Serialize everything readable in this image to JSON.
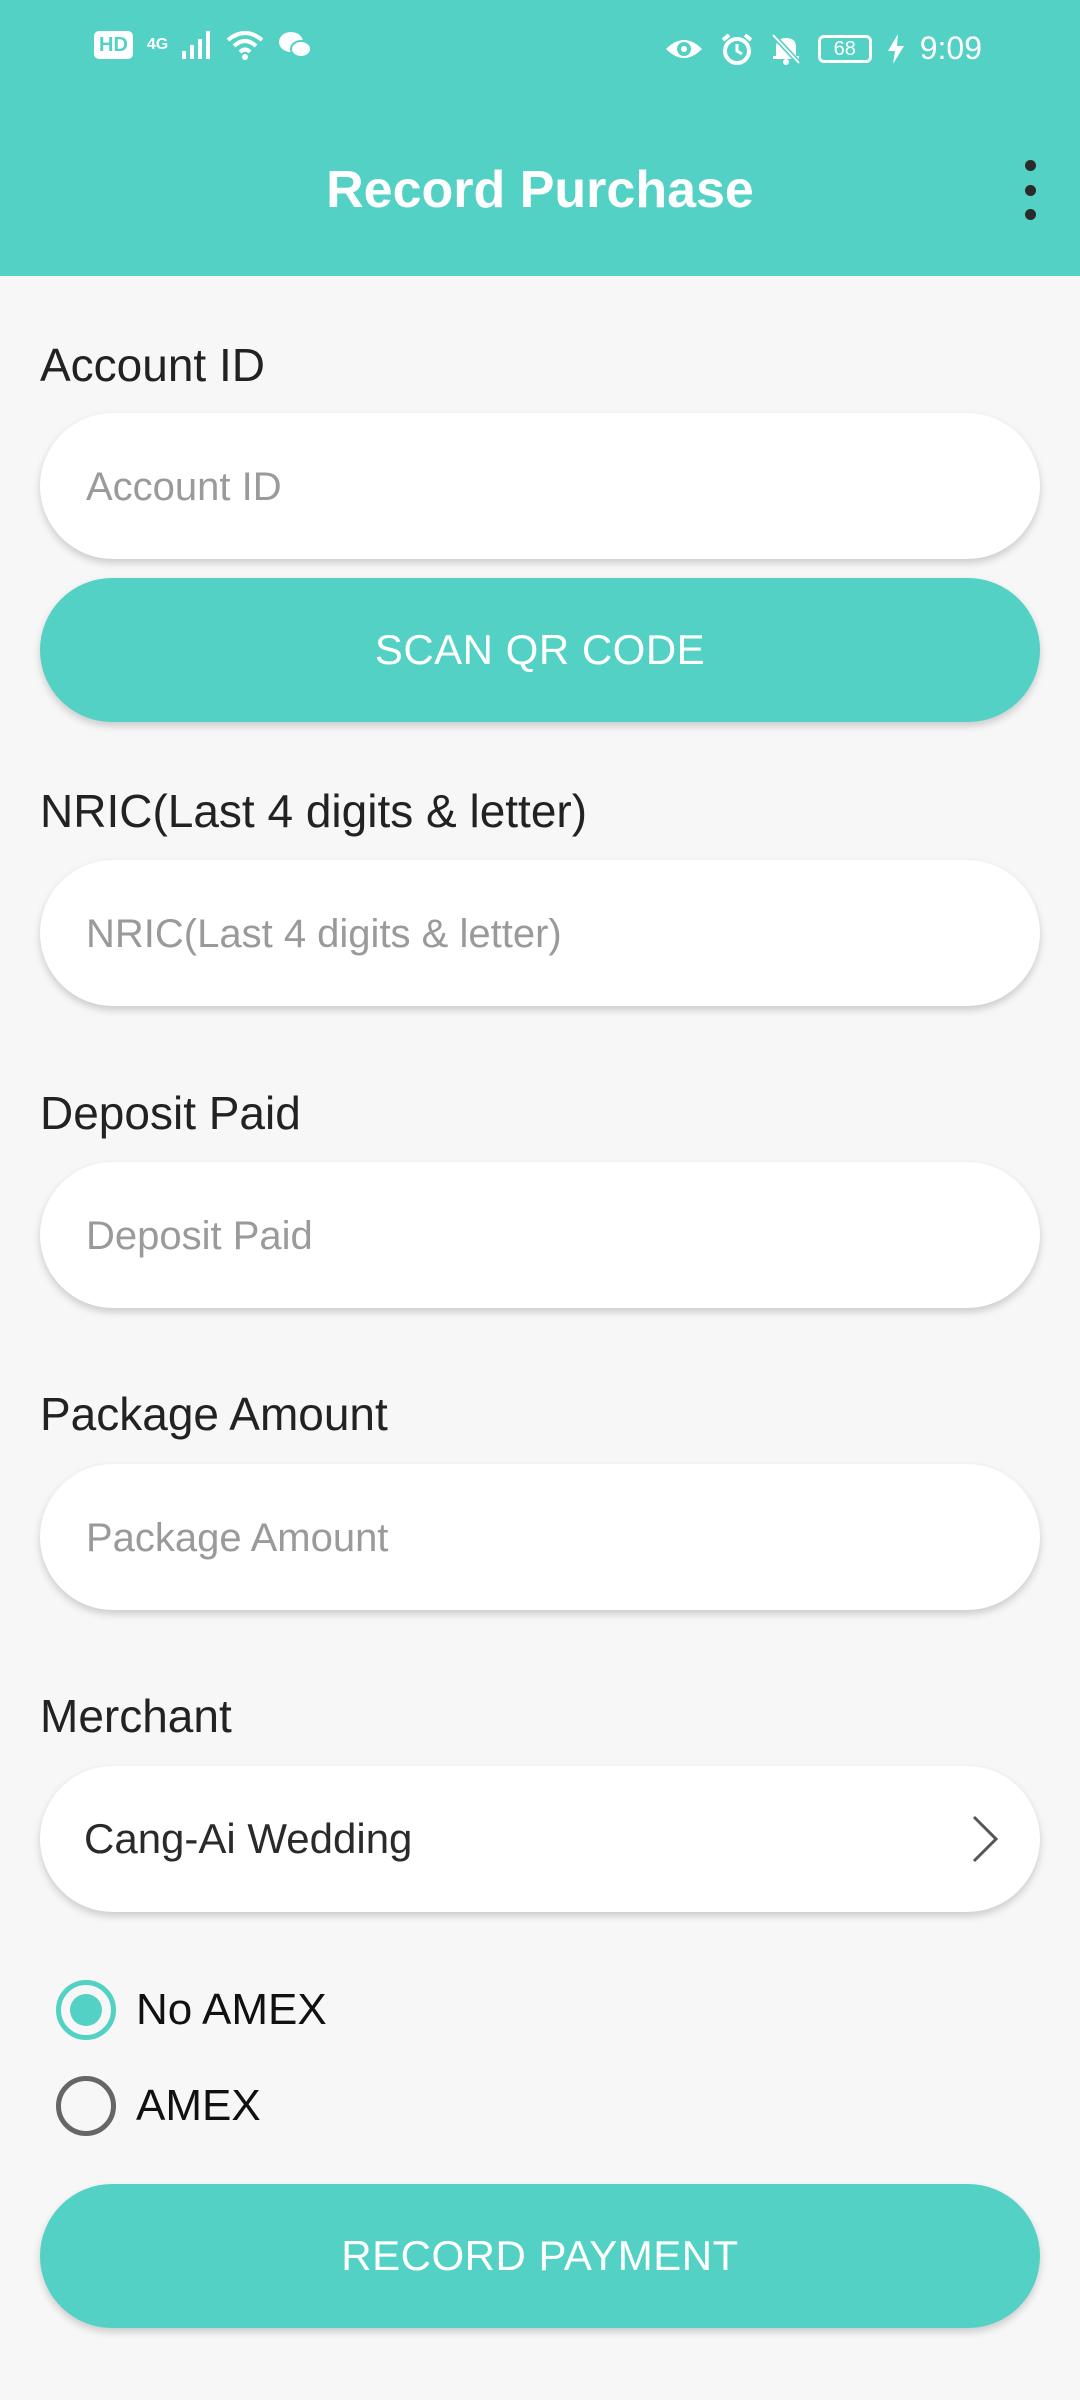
{
  "statusbar": {
    "hd": "HD",
    "network": "4G",
    "battery": "68",
    "time": "9:09",
    "icons": [
      "signal-icon",
      "wifi-icon",
      "wechat-icon",
      "eye-icon",
      "alarm-icon",
      "mute-icon",
      "charging-icon"
    ]
  },
  "appbar": {
    "title": "Record Purchase",
    "menu_icon": "more-vert-icon"
  },
  "form": {
    "account_id": {
      "label": "Account ID",
      "placeholder": "Account ID"
    },
    "scan_button": "SCAN QR CODE",
    "nric": {
      "label": "NRIC(Last 4 digits & letter)",
      "placeholder": "NRIC(Last 4 digits & letter)"
    },
    "deposit": {
      "label": "Deposit Paid",
      "placeholder": "Deposit Paid"
    },
    "package": {
      "label": "Package Amount",
      "placeholder": "Package Amount"
    },
    "merchant": {
      "label": "Merchant",
      "value": "Cang-Ai Wedding"
    },
    "payment_type": {
      "options": [
        {
          "label": "No AMEX",
          "selected": true
        },
        {
          "label": "AMEX",
          "selected": false
        }
      ]
    },
    "record_button": "RECORD PAYMENT"
  },
  "colors": {
    "accent": "#52d1c4",
    "background": "#f7f7f7"
  }
}
